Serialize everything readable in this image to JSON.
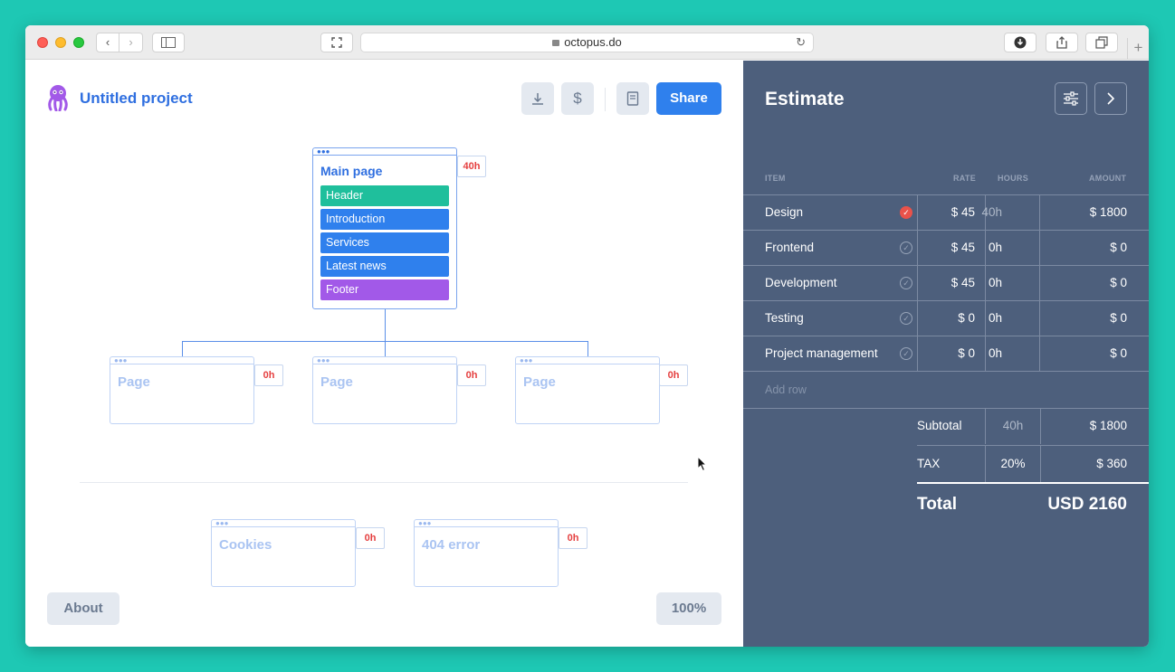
{
  "browser": {
    "url": "octopus.do",
    "back_icon": "chevron-left-icon",
    "forward_icon": "chevron-right-icon"
  },
  "toolbar": {
    "project_title": "Untitled project",
    "share_label": "Share"
  },
  "sitemap": {
    "main_page": {
      "title": "Main page",
      "hours": "40h",
      "sections": [
        {
          "label": "Header",
          "color": "#1fbf9c"
        },
        {
          "label": "Introduction",
          "color": "#2f80ed"
        },
        {
          "label": "Services",
          "color": "#2f80ed"
        },
        {
          "label": "Latest news",
          "color": "#2f80ed"
        },
        {
          "label": "Footer",
          "color": "#a259e8"
        }
      ]
    },
    "child_pages": [
      {
        "title": "Page",
        "hours": "0h"
      },
      {
        "title": "Page",
        "hours": "0h"
      },
      {
        "title": "Page",
        "hours": "0h"
      }
    ],
    "extra_pages": [
      {
        "title": "Cookies",
        "hours": "0h"
      },
      {
        "title": "404 error",
        "hours": "0h"
      }
    ]
  },
  "footer": {
    "about_label": "About",
    "zoom_label": "100%"
  },
  "estimate": {
    "title": "Estimate",
    "columns": {
      "item": "ITEM",
      "rate": "RATE",
      "hours": "HOURS",
      "amount": "AMOUNT"
    },
    "rows": [
      {
        "item": "Design",
        "rate": "$ 45",
        "hours": "40h",
        "amount": "$ 1800",
        "checked": true
      },
      {
        "item": "Frontend",
        "rate": "$ 45",
        "hours": "0h",
        "amount": "$ 0",
        "checked": false
      },
      {
        "item": "Development",
        "rate": "$ 45",
        "hours": "0h",
        "amount": "$ 0",
        "checked": false
      },
      {
        "item": "Testing",
        "rate": "$ 0",
        "hours": "0h",
        "amount": "$ 0",
        "checked": false
      },
      {
        "item": "Project management",
        "rate": "$ 0",
        "hours": "0h",
        "amount": "$ 0",
        "checked": false
      }
    ],
    "add_row_label": "Add row",
    "subtotal": {
      "label": "Subtotal",
      "hours": "40h",
      "amount": "$ 1800"
    },
    "tax": {
      "label": "TAX",
      "rate": "20%",
      "amount": "$ 360"
    },
    "total": {
      "label": "Total",
      "amount": "USD 2160"
    }
  },
  "colors": {
    "accent": "#2f80ed",
    "panel": "#4d5f7c",
    "hours_text": "#e54040",
    "background": "#1ec8b4"
  }
}
